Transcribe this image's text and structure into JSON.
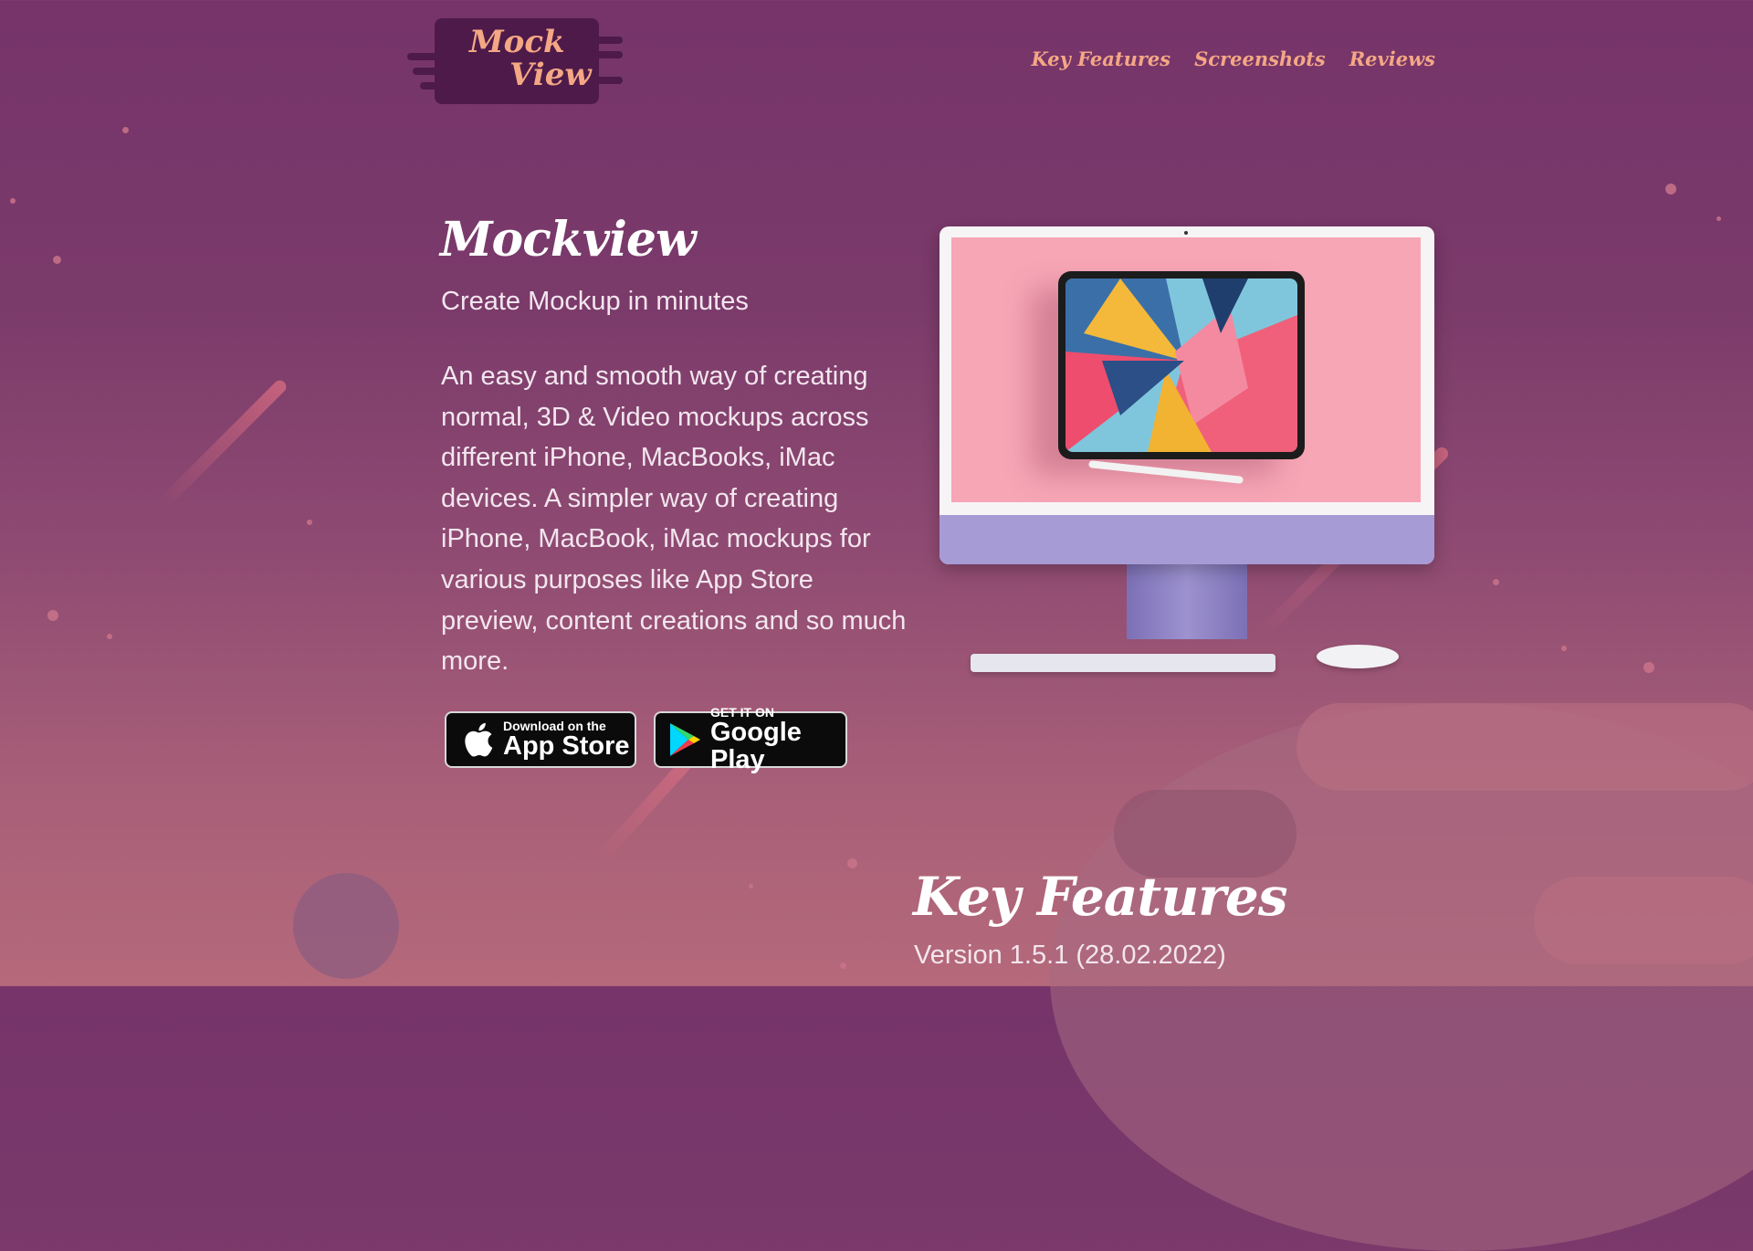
{
  "header": {
    "logo_line1": "Mock",
    "logo_line2": "View",
    "nav": [
      "Key Features",
      "Screenshots",
      "Reviews"
    ]
  },
  "hero": {
    "title": "Mockview",
    "tagline": "Create Mockup in minutes",
    "description": "An easy and smooth way of creating normal, 3D & Video mockups across different iPhone, MacBooks, iMac devices. A simpler way of creating iPhone, MacBook, iMac mockups for various purposes like App Store preview, content creations and so much more."
  },
  "store_buttons": {
    "appstore_small": "Download on the",
    "appstore_big": "App Store",
    "google_small": "GET IT ON",
    "google_big": "Google Play"
  },
  "key_features": {
    "title": "Key Features",
    "version": "Version 1.5.1 (28.02.2022)"
  },
  "colors": {
    "accent": "#f4a784",
    "logo_bg": "#4d1a4a",
    "bg_top": "#76346a",
    "bg_bottom": "#b5697a"
  },
  "icons": [
    "apple-icon",
    "google-play-icon"
  ]
}
